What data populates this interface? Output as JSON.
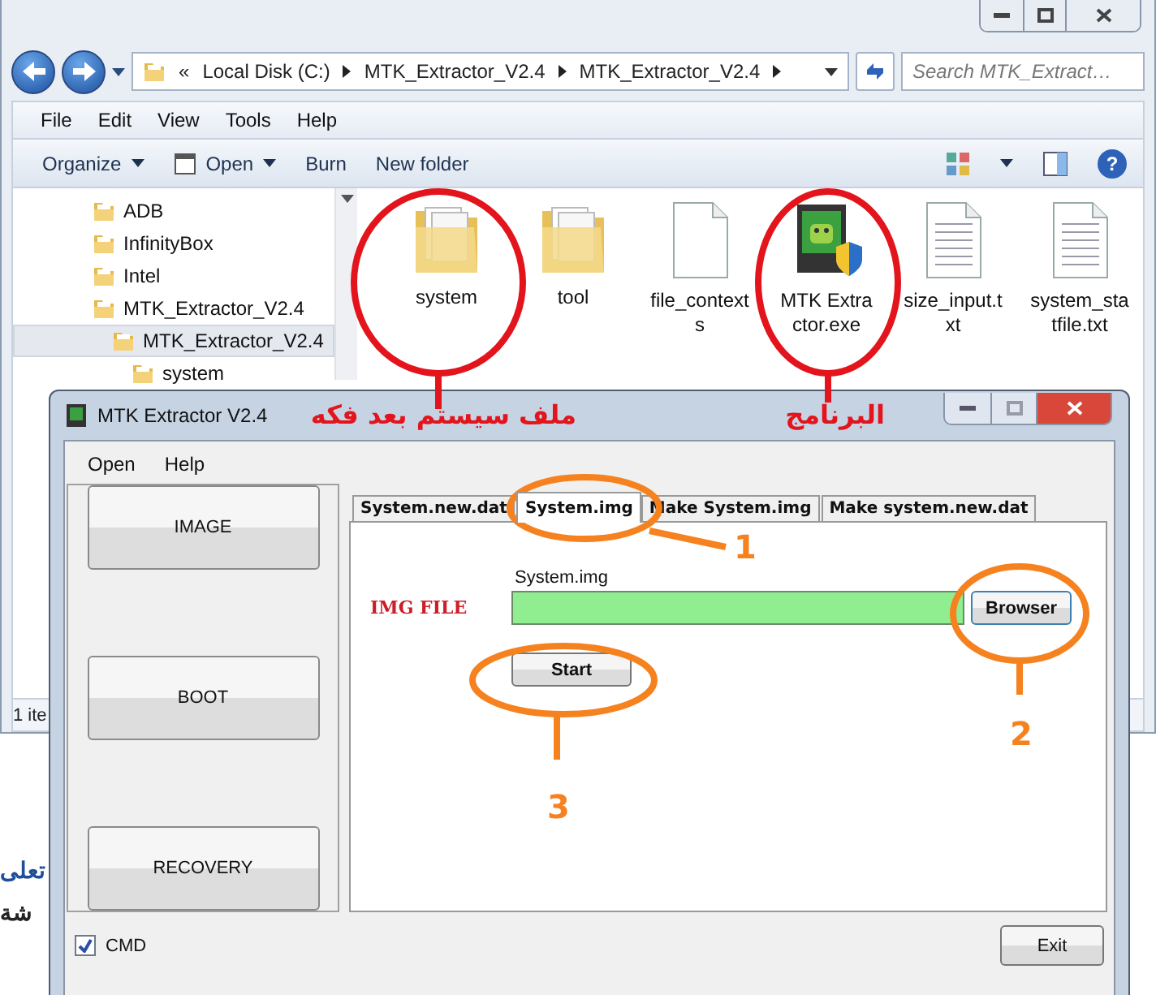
{
  "explorer": {
    "address": {
      "overflow": "«",
      "crumbs": [
        "Local Disk (C:)",
        "MTK_Extractor_V2.4",
        "MTK_Extractor_V2.4"
      ]
    },
    "search": {
      "placeholder": "Search MTK_Extract…"
    },
    "menu": [
      "File",
      "Edit",
      "View",
      "Tools",
      "Help"
    ],
    "toolbar": [
      {
        "label": "Organize",
        "dropdown": true,
        "kind": "plain"
      },
      {
        "label": "Open",
        "dropdown": true,
        "kind": "open"
      },
      {
        "label": "Burn",
        "dropdown": false,
        "kind": "plain"
      },
      {
        "label": "New folder",
        "dropdown": false,
        "kind": "plain"
      }
    ],
    "help_button": "?",
    "tree": [
      {
        "label": "ADB",
        "selected": false
      },
      {
        "label": "InfinityBox",
        "selected": false
      },
      {
        "label": "Intel",
        "selected": false
      },
      {
        "label": "MTK_Extractor_V2.4",
        "selected": false,
        "children": [
          {
            "label": "MTK_Extractor_V2.4",
            "selected": true,
            "children": [
              {
                "label": "system",
                "selected": false
              }
            ]
          }
        ]
      }
    ],
    "files": [
      {
        "name": "system",
        "kind": "folder"
      },
      {
        "name": "tool",
        "kind": "folder"
      },
      {
        "name": "file_contexts",
        "kind": "document"
      },
      {
        "name": "MTK Extractor.exe",
        "kind": "app"
      },
      {
        "name": "size_input.txt",
        "kind": "text"
      },
      {
        "name": "system_statfile.txt",
        "kind": "text"
      }
    ],
    "status_bar": "1 ite"
  },
  "background_texts": [
    "تعلى",
    "شة"
  ],
  "mtk_window": {
    "title": "MTK Extractor V2.4",
    "menu": [
      "Open",
      "Help"
    ],
    "side_buttons": [
      "IMAGE",
      "BOOT",
      "RECOVERY"
    ],
    "tabs": [
      {
        "label": "System.new.dat",
        "selected": false
      },
      {
        "label": "System.img",
        "selected": true
      },
      {
        "label": "Make System.img",
        "selected": false
      },
      {
        "label": "Make system.new.dat",
        "selected": false
      }
    ],
    "file_label": "System.img",
    "field_label": "IMG FILE",
    "browse_button": "Browser",
    "start_button": "Start",
    "cmd": {
      "label": "CMD",
      "checked": true
    },
    "exit_button": "Exit"
  },
  "annotations": [
    {
      "kind": "note",
      "text": "ملف سيستم بعد فكه",
      "color": "#e3141c"
    },
    {
      "kind": "note",
      "text": "البرنامج",
      "color": "#e3141c"
    },
    {
      "kind": "step",
      "text": "1",
      "color": "#f5821f"
    },
    {
      "kind": "step",
      "text": "2",
      "color": "#f5821f"
    },
    {
      "kind": "step",
      "text": "3",
      "color": "#f5821f"
    }
  ]
}
